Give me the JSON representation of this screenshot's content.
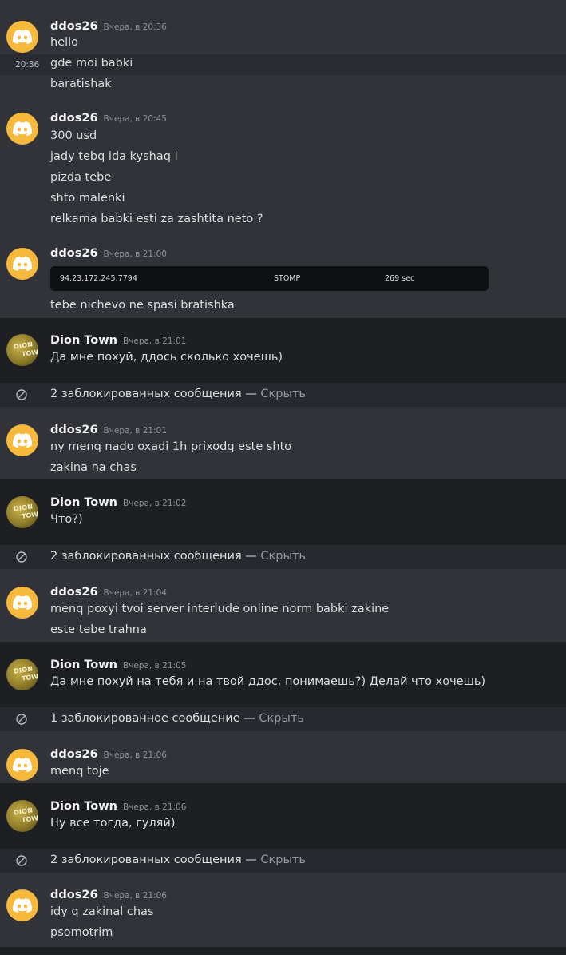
{
  "blocks": [
    {
      "author": "ddos26",
      "time": "Вчера, в 20:36",
      "messages": [
        "hello",
        "gde moi babki",
        "baratishak"
      ],
      "hover_time": "20:36"
    },
    {
      "author": "ddos26",
      "time": "Вчера, в 20:45",
      "messages": [
        "300 usd",
        "jady tebq  ida kyshaq i",
        "pizda tebe",
        "shto malenki",
        "relkama babki esti za zashtita neto ?"
      ]
    },
    {
      "author": "ddos26",
      "time": "Вчера, в 21:00",
      "embed": {
        "ip": "94.23.172.245:7794",
        "method": "STOMP",
        "duration": "269 sec"
      },
      "messages": [
        "tebe nichevo ne spasi bratishka"
      ]
    },
    {
      "author": "Dion Town",
      "time": "Вчера, в 21:01",
      "messages": [
        "Да мне похуй, ддось сколько хочешь)"
      ],
      "avatar_text": [
        "DION",
        "TOWN"
      ]
    },
    {
      "blocked": "2 заблокированных сообщения —",
      "show": "Скрыть"
    },
    {
      "author": "ddos26",
      "time": "Вчера, в 21:01",
      "messages": [
        "ny menq nado oxadi 1h prixodq este shto",
        "zakina na chas"
      ]
    },
    {
      "author": "Dion Town",
      "time": "Вчера, в 21:02",
      "messages": [
        "Что?)"
      ],
      "avatar_text": [
        "DION",
        "TOWN"
      ]
    },
    {
      "blocked": "2 заблокированных сообщения —",
      "show": "Скрыть"
    },
    {
      "author": "ddos26",
      "time": "Вчера, в 21:04",
      "messages": [
        "menq poxyi tvoi server interlude online norm babki zakine",
        "este tebe trahna"
      ]
    },
    {
      "author": "Dion Town",
      "time": "Вчера, в 21:05",
      "messages": [
        "Да мне похуй на тебя и на твой ддос, понимаешь?) Делай что хочешь)"
      ],
      "avatar_text": [
        "DION",
        "TOWN"
      ]
    },
    {
      "blocked": "1 заблокированное сообщение —",
      "show": "Скрыть"
    },
    {
      "author": "ddos26",
      "time": "Вчера, в 21:06",
      "messages": [
        "menq toje"
      ]
    },
    {
      "author": "Dion Town",
      "time": "Вчера, в 21:06",
      "messages": [
        "Ну все тогда, гуляй)"
      ],
      "avatar_text": [
        "DION",
        "TOWN"
      ]
    },
    {
      "blocked": "2 заблокированных сообщения —",
      "show": "Скрыть"
    },
    {
      "author": "ddos26",
      "time": "Вчера, в 21:06",
      "messages": [
        "idy q zakinal chas",
        "psomotrim"
      ]
    }
  ]
}
